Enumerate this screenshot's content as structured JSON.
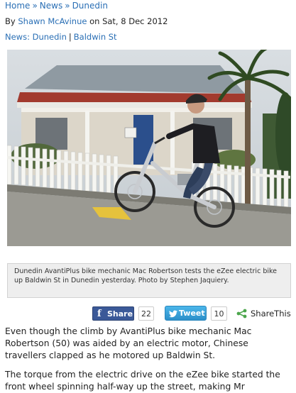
{
  "breadcrumb": {
    "items": [
      "Home",
      "News",
      "Dunedin"
    ],
    "separator": "»"
  },
  "byline": {
    "prefix": "By",
    "author": "Shawn McAvinue",
    "on": "on",
    "date": "Sat, 8 Dec 2012"
  },
  "tags": {
    "primary": "News: Dunedin",
    "divider": "|",
    "secondary": "Baldwin St"
  },
  "photo": {
    "caption": "Dunedin AvantiPlus bike mechanic Mac Robertson tests the eZee electric bike up Baldwin St in Dunedin yesterday. Photo by Stephen Jaquiery."
  },
  "share": {
    "facebook_label": "Share",
    "facebook_count": "22",
    "twitter_label": "Tweet",
    "twitter_count": "10",
    "sharethis_label": "ShareThis"
  },
  "article": {
    "paragraphs": [
      "Even though the climb by AvantiPlus bike mechanic Mac Robertson (50) was aided by an electric motor, Chinese travellers clapped as he motored up Baldwin St.",
      "The torque from the electric drive on the eZee bike started the front wheel spinning half-way up the street, making Mr"
    ]
  },
  "colors": {
    "link": "#2a6fb5",
    "facebook": "#3b5998",
    "twitter": "#2b8fc9",
    "caption_bg": "#eeeeee"
  },
  "icons": [
    "facebook-icon",
    "twitter-icon",
    "sharethis-icon"
  ]
}
